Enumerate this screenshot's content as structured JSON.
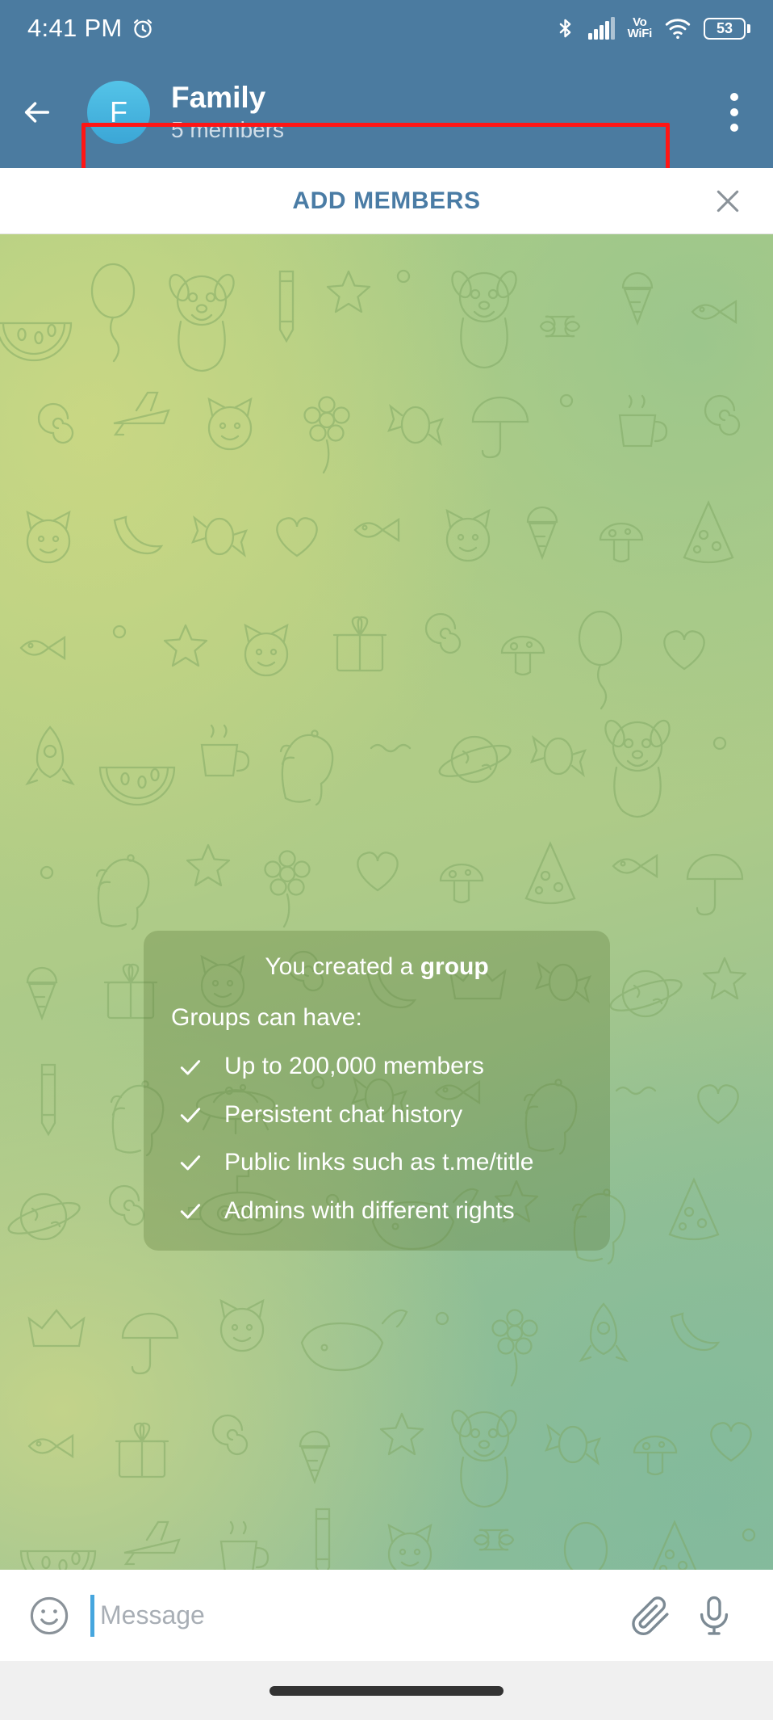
{
  "status_bar": {
    "time": "4:41 PM",
    "alarm_icon": "alarm-clock-icon",
    "bluetooth_icon": "bluetooth-icon",
    "signal_icon": "cellular-signal-icon",
    "vowifi_line1": "Vo",
    "vowifi_line2": "WiFi",
    "wifi_icon": "wifi-icon",
    "battery_level": "53",
    "background_color": "#4B7BA0"
  },
  "app_bar": {
    "back_icon": "back-arrow-icon",
    "avatar_letter": "F",
    "title": "Family",
    "subtitle": "5 members",
    "menu_icon": "overflow-menu-icon",
    "highlight_color": "#FF1515",
    "background_color": "#4B7BA0"
  },
  "add_members_bar": {
    "label": "ADD MEMBERS",
    "label_color": "#4A7CA5",
    "close_icon": "close-x-icon"
  },
  "service_message": {
    "headline_prefix": "You created a ",
    "headline_bold": "group",
    "intro": "Groups can have:",
    "features": [
      "Up to 200,000 members",
      "Persistent chat history",
      "Public links such as t.me/title",
      "Admins with different rights"
    ],
    "check_icon": "checkmark-icon"
  },
  "input_bar": {
    "emoji_icon": "emoji-smiley-icon",
    "placeholder": "Message",
    "attach_icon": "paperclip-icon",
    "mic_icon": "microphone-icon",
    "caret_color": "#46A6DE"
  },
  "nav_bar": {
    "handle": "gesture-navigation-pill"
  },
  "wallpaper": {
    "style": "telegram-doodle-pattern",
    "accent_top": "#CDD983",
    "accent_bottom": "#81BA9C"
  }
}
